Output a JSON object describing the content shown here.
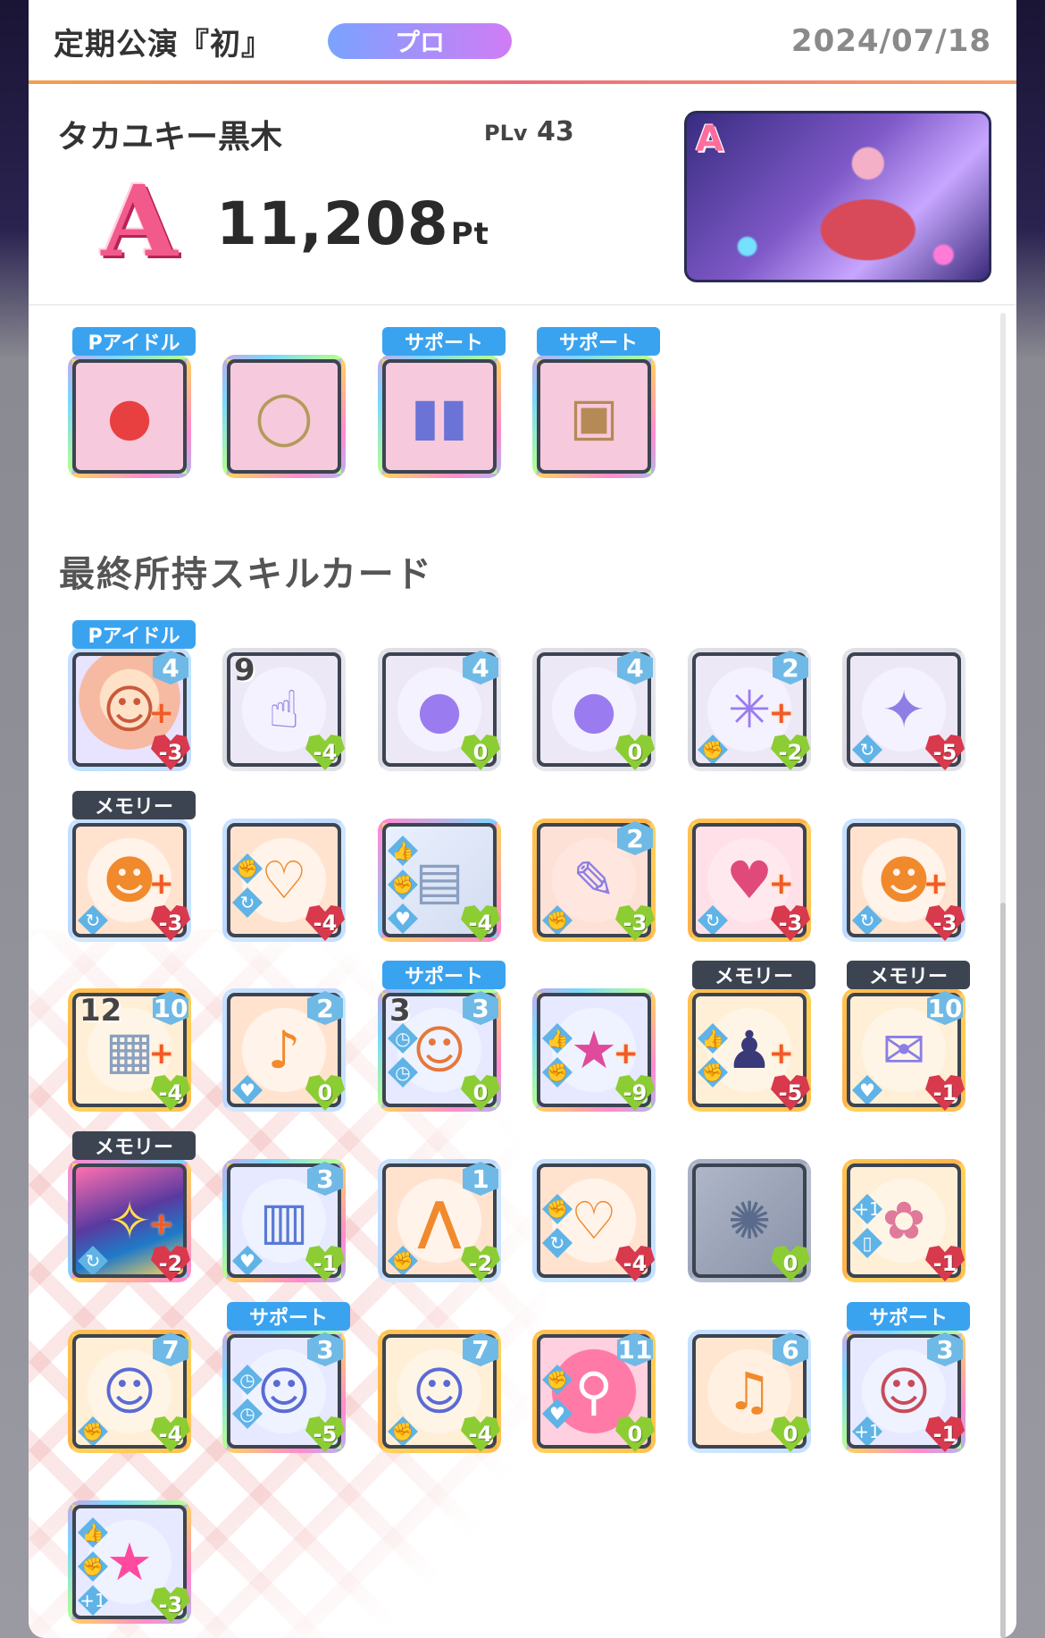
{
  "header": {
    "title": "定期公演『初』",
    "badge": "プロ",
    "date": "2024/07/18"
  },
  "player": {
    "name": "タカユキー黒木",
    "plv_label": "PLv",
    "plv": "43",
    "rank": "A",
    "score": "11,208",
    "unit": "Pt",
    "thumb_rank": "A"
  },
  "items": [
    {
      "tag": "Pアイドル",
      "tag_style": "blue",
      "name": "mascot-keychain",
      "glyph": "●",
      "color": "#e84040",
      "frame": "rainbow",
      "bg": "#f7c9dc"
    },
    {
      "tag": "",
      "tag_style": "",
      "name": "bracelet",
      "glyph": "◯",
      "color": "#b39a5a",
      "frame": "rainbow",
      "bg": "#f7c9dc"
    },
    {
      "tag": "サポート",
      "tag_style": "blue",
      "name": "drink-cans",
      "glyph": "▮▮",
      "color": "#6b73d6",
      "frame": "rainbow",
      "bg": "#f7c9dc"
    },
    {
      "tag": "サポート",
      "tag_style": "blue",
      "name": "box-of-items",
      "glyph": "▣",
      "color": "#b58a56",
      "frame": "rainbow",
      "bg": "#f7c9dc"
    }
  ],
  "section_title": "最終所持スキルカード",
  "cards": [
    {
      "tag": "Pアイドル",
      "tag_style": "blue",
      "lvl": "4",
      "cost": "-3",
      "cost_color": "red",
      "plus": true,
      "uses": "",
      "theme": "portrait",
      "glyph": "☺",
      "glyph_color": "#c85a3a",
      "icons": []
    },
    {
      "tag": "",
      "tag_style": "",
      "lvl": "",
      "cost": "-4",
      "cost_color": "green",
      "plus": false,
      "uses": "9",
      "theme": "lavender",
      "glyph": "☝",
      "glyph_color": "#8e7ee6",
      "icons": []
    },
    {
      "tag": "",
      "tag_style": "",
      "lvl": "4",
      "cost": "0",
      "cost_color": "green",
      "plus": false,
      "uses": "",
      "theme": "lavender",
      "glyph": "●",
      "glyph_color": "#9a7cf0",
      "icons": []
    },
    {
      "tag": "",
      "tag_style": "",
      "lvl": "4",
      "cost": "0",
      "cost_color": "green",
      "plus": false,
      "uses": "",
      "theme": "lavender",
      "glyph": "●",
      "glyph_color": "#9a7cf0",
      "icons": []
    },
    {
      "tag": "",
      "tag_style": "",
      "lvl": "2",
      "cost": "-2",
      "cost_color": "green",
      "plus": true,
      "uses": "",
      "theme": "lavender",
      "glyph": "✳",
      "glyph_color": "#9a7cf0",
      "icons": [
        "fist"
      ]
    },
    {
      "tag": "",
      "tag_style": "",
      "lvl": "",
      "cost": "-5",
      "cost_color": "red",
      "plus": false,
      "uses": "",
      "theme": "lavender",
      "glyph": "✦",
      "glyph_color": "#8e7ee6",
      "icons": [
        "loop"
      ]
    },
    {
      "tag": "メモリー",
      "tag_style": "dark",
      "lvl": "",
      "cost": "-3",
      "cost_color": "red",
      "plus": true,
      "uses": "",
      "theme": "orange",
      "glyph": "☻",
      "glyph_color": "#f08a2c",
      "icons": [
        "loop"
      ]
    },
    {
      "tag": "",
      "tag_style": "",
      "lvl": "",
      "cost": "-4",
      "cost_color": "red",
      "plus": false,
      "uses": "",
      "theme": "orange",
      "glyph": "♡",
      "glyph_color": "#f08a2c",
      "icons": [
        "fist",
        "loop"
      ]
    },
    {
      "tag": "",
      "tag_style": "",
      "lvl": "",
      "cost": "-4",
      "cost_color": "green",
      "plus": false,
      "uses": "",
      "theme": "notebook",
      "glyph": "▤",
      "glyph_color": "#8aa0c0",
      "icons": [
        "thumb",
        "fist",
        "heart"
      ]
    },
    {
      "tag": "",
      "tag_style": "",
      "lvl": "2",
      "cost": "-3",
      "cost_color": "green",
      "plus": false,
      "uses": "",
      "theme": "peach",
      "glyph": "✎",
      "glyph_color": "#8a7ee6",
      "icons": [
        "fist"
      ]
    },
    {
      "tag": "",
      "tag_style": "",
      "lvl": "",
      "cost": "-3",
      "cost_color": "red",
      "plus": true,
      "uses": "",
      "theme": "pinkgold",
      "glyph": "♥",
      "glyph_color": "#e04a7a",
      "icons": [
        "loop"
      ]
    },
    {
      "tag": "",
      "tag_style": "",
      "lvl": "",
      "cost": "-3",
      "cost_color": "red",
      "plus": true,
      "uses": "",
      "theme": "orange",
      "glyph": "☻",
      "glyph_color": "#f08a2c",
      "icons": [
        "loop"
      ]
    },
    {
      "tag": "",
      "tag_style": "",
      "lvl": "10",
      "cost": "-4",
      "cost_color": "green",
      "plus": true,
      "uses": "12",
      "theme": "gold",
      "glyph": "▦",
      "glyph_color": "#8aa0c0",
      "icons": []
    },
    {
      "tag": "",
      "tag_style": "",
      "lvl": "2",
      "cost": "0",
      "cost_color": "green",
      "plus": false,
      "uses": "",
      "theme": "orange",
      "glyph": "♪",
      "glyph_color": "#f08a2c",
      "icons": [
        "heart"
      ]
    },
    {
      "tag": "サポート",
      "tag_style": "blue",
      "lvl": "3",
      "cost": "0",
      "cost_color": "green",
      "plus": false,
      "uses": "3",
      "theme": "rainbow",
      "glyph": "☺",
      "glyph_color": "#e6773a",
      "icons": [
        "clock",
        "clock"
      ]
    },
    {
      "tag": "",
      "tag_style": "",
      "lvl": "",
      "cost": "-9",
      "cost_color": "green",
      "plus": true,
      "uses": "",
      "theme": "rainbow",
      "glyph": "★",
      "glyph_color": "#e04a9a",
      "icons": [
        "thumb",
        "fist"
      ]
    },
    {
      "tag": "メモリー",
      "tag_style": "dark",
      "lvl": "",
      "cost": "-5",
      "cost_color": "red",
      "plus": true,
      "uses": "",
      "theme": "gold",
      "glyph": "♟",
      "glyph_color": "#3a3a7a",
      "icons": [
        "thumb",
        "fist"
      ]
    },
    {
      "tag": "メモリー",
      "tag_style": "dark",
      "lvl": "10",
      "cost": "-1",
      "cost_color": "red",
      "plus": false,
      "uses": "",
      "theme": "gold",
      "glyph": "✉",
      "glyph_color": "#8a7ee6",
      "icons": [
        "heart"
      ]
    },
    {
      "tag": "メモリー",
      "tag_style": "dark",
      "lvl": "",
      "cost": "-2",
      "cost_color": "red",
      "plus": true,
      "uses": "",
      "theme": "stage",
      "glyph": "✧",
      "glyph_color": "#ffe04a",
      "icons": [
        "loop"
      ]
    },
    {
      "tag": "",
      "tag_style": "",
      "lvl": "3",
      "cost": "-1",
      "cost_color": "green",
      "plus": false,
      "uses": "",
      "theme": "rainbow",
      "glyph": "▥",
      "glyph_color": "#5a7ad6",
      "icons": [
        "heart"
      ]
    },
    {
      "tag": "",
      "tag_style": "",
      "lvl": "1",
      "cost": "-2",
      "cost_color": "green",
      "plus": false,
      "uses": "",
      "theme": "orange",
      "glyph": "⋀",
      "glyph_color": "#f08a2c",
      "icons": [
        "fist"
      ]
    },
    {
      "tag": "",
      "tag_style": "",
      "lvl": "",
      "cost": "-4",
      "cost_color": "red",
      "plus": false,
      "uses": "",
      "theme": "orange",
      "glyph": "♡",
      "glyph_color": "#f08a2c",
      "icons": [
        "fist",
        "loop"
      ]
    },
    {
      "tag": "",
      "tag_style": "",
      "lvl": "",
      "cost": "0",
      "cost_color": "green",
      "plus": false,
      "uses": "",
      "theme": "gray",
      "glyph": "✺",
      "glyph_color": "#5a6a8a",
      "icons": []
    },
    {
      "tag": "",
      "tag_style": "",
      "lvl": "",
      "cost": "-1",
      "cost_color": "red",
      "plus": false,
      "uses": "",
      "theme": "gold",
      "glyph": "✿",
      "glyph_color": "#e07a9a",
      "icons": [
        "plus1",
        "phone"
      ]
    },
    {
      "tag": "",
      "tag_style": "",
      "lvl": "7",
      "cost": "-4",
      "cost_color": "green",
      "plus": false,
      "uses": "",
      "theme": "gold",
      "glyph": "☺",
      "glyph_color": "#5a6ad6",
      "icons": [
        "fist"
      ]
    },
    {
      "tag": "サポート",
      "tag_style": "blue",
      "lvl": "3",
      "cost": "-5",
      "cost_color": "green",
      "plus": false,
      "uses": "",
      "theme": "rainbow",
      "glyph": "☺",
      "glyph_color": "#5a6ad6",
      "icons": [
        "clock",
        "clock"
      ]
    },
    {
      "tag": "",
      "tag_style": "",
      "lvl": "7",
      "cost": "-4",
      "cost_color": "green",
      "plus": false,
      "uses": "",
      "theme": "gold",
      "glyph": "☺",
      "glyph_color": "#5a6ad6",
      "icons": [
        "fist"
      ]
    },
    {
      "tag": "",
      "tag_style": "",
      "lvl": "11",
      "cost": "0",
      "cost_color": "green",
      "plus": false,
      "uses": "",
      "theme": "pinkwave",
      "glyph": "⚲",
      "glyph_color": "#ffffff",
      "icons": [
        "fist",
        "heart"
      ]
    },
    {
      "tag": "",
      "tag_style": "",
      "lvl": "6",
      "cost": "0",
      "cost_color": "green",
      "plus": false,
      "uses": "",
      "theme": "orangecircle",
      "glyph": "♫",
      "glyph_color": "#f08a2c",
      "icons": []
    },
    {
      "tag": "サポート",
      "tag_style": "blue",
      "lvl": "3",
      "cost": "-1",
      "cost_color": "red",
      "plus": false,
      "uses": "",
      "theme": "rainbow",
      "glyph": "☺",
      "glyph_color": "#c84a5a",
      "icons": [
        "plus1"
      ]
    },
    {
      "tag": "",
      "tag_style": "",
      "lvl": "",
      "cost": "-3",
      "cost_color": "green",
      "plus": false,
      "uses": "",
      "theme": "rainbow",
      "glyph": "★",
      "glyph_color": "#ff4aa0",
      "icons": [
        "thumb",
        "fist",
        "plus1"
      ]
    }
  ],
  "colors": {
    "accent_gradient_start": "#7aa3ff",
    "accent_gradient_end": "#d07cf5",
    "red_cost": "#d8394c",
    "green_cost": "#8ccd34",
    "tag_blue": "#3aa3f0",
    "tag_dark": "#3d4451"
  }
}
